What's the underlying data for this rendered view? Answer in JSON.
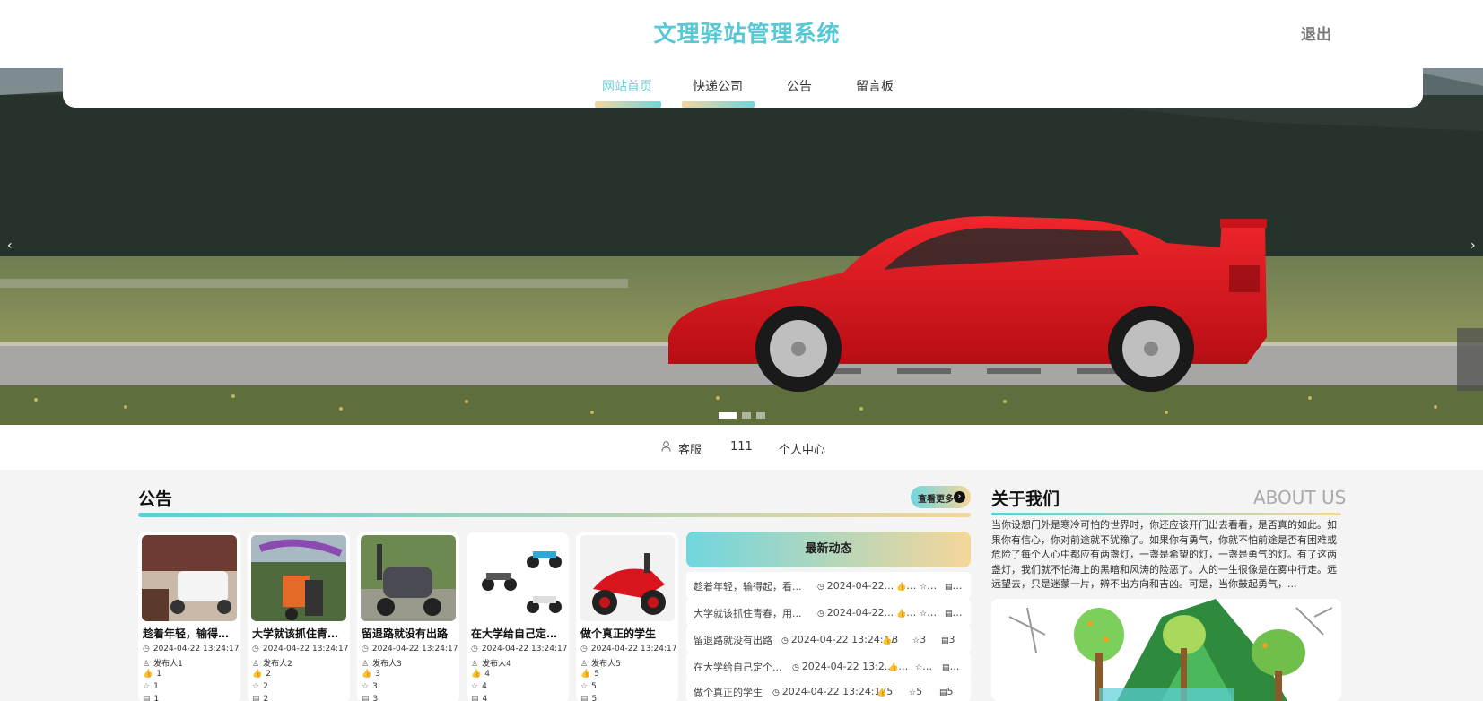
{
  "header": {
    "site_title": "文理驿站管理系统",
    "logout_label": "退出"
  },
  "nav": {
    "items": [
      {
        "label": "网站首页",
        "active": true
      },
      {
        "label": "快递公司",
        "active": false
      },
      {
        "label": "公告",
        "active": false
      },
      {
        "label": "留言板",
        "active": false
      }
    ]
  },
  "banner": {
    "prev_symbol": "‹",
    "next_symbol": "›",
    "slide_count": 3,
    "current_slide": 1
  },
  "userbar": {
    "user_icon": "user-icon",
    "role": "客服",
    "username": "111",
    "profile_link": "个人中心"
  },
  "notice_section": {
    "title": "公告",
    "more_label": "查看更多",
    "more_icon": "arrow-right-circle-icon",
    "cards": [
      {
        "title": "趁着年轻，输得起，看得开",
        "time": "2024-04-22 13:24:17",
        "publisher": "发布人1",
        "likes": "1",
        "favorites": "1",
        "views": "1"
      },
      {
        "title": "大学就该抓住青春，用力奔跑",
        "time": "2024-04-22 13:24:17",
        "publisher": "发布人2",
        "likes": "2",
        "favorites": "2",
        "views": "2"
      },
      {
        "title": "留退路就没有出路",
        "time": "2024-04-22 13:24:17",
        "publisher": "发布人3",
        "likes": "3",
        "favorites": "3",
        "views": "3"
      },
      {
        "title": "在大学给自己定个目标",
        "time": "2024-04-22 13:24:17",
        "publisher": "发布人4",
        "likes": "4",
        "favorites": "4",
        "views": "4"
      },
      {
        "title": "做个真正的学生",
        "time": "2024-04-22 13:24:17",
        "publisher": "发布人5",
        "likes": "5",
        "favorites": "5",
        "views": "5"
      }
    ]
  },
  "news": {
    "title": "最新动态",
    "rows": [
      {
        "title": "趁着年轻，输得起，看...",
        "time": "2024-04-22...",
        "likes": "…",
        "favorites": "…",
        "views": "…"
      },
      {
        "title": "大学就该抓住青春，用...",
        "time": "2024-04-22...",
        "likes": "…",
        "favorites": "…",
        "views": "…"
      },
      {
        "title": "留退路就没有出路",
        "time": "2024-04-22 13:24:17",
        "likes": "3",
        "favorites": "3",
        "views": "3"
      },
      {
        "title": "在大学给自己定个...",
        "time": "2024-04-22 13:2...",
        "likes": "…",
        "favorites": "…",
        "views": "…"
      },
      {
        "title": "做个真正的学生",
        "time": "2024-04-22 13:24:17",
        "likes": "5",
        "favorites": "5",
        "views": "5"
      }
    ]
  },
  "about": {
    "title": "关于我们",
    "title_en": "ABOUT US",
    "text": "当你设想门外是寒冷可怕的世界时，你还应该开门出去看看，是否真的如此。如果你有信心，你对前途就不犹豫了。如果你有勇气，你就不怕前途是否有困难或危险了每个人心中都应有两盏灯，一盏是希望的灯，一盏是勇气的灯。有了这两盏灯，我们就不怕海上的黑暗和风涛的险恶了。人的一生很像是在雾中行走。远远望去，只是迷蒙一片，辨不出方向和吉凶。可是，当你鼓起勇气，..."
  },
  "colors": {
    "accent_teal": "#56c8d6",
    "accent_gold": "#f5d69a",
    "car_red": "#e0141c"
  }
}
